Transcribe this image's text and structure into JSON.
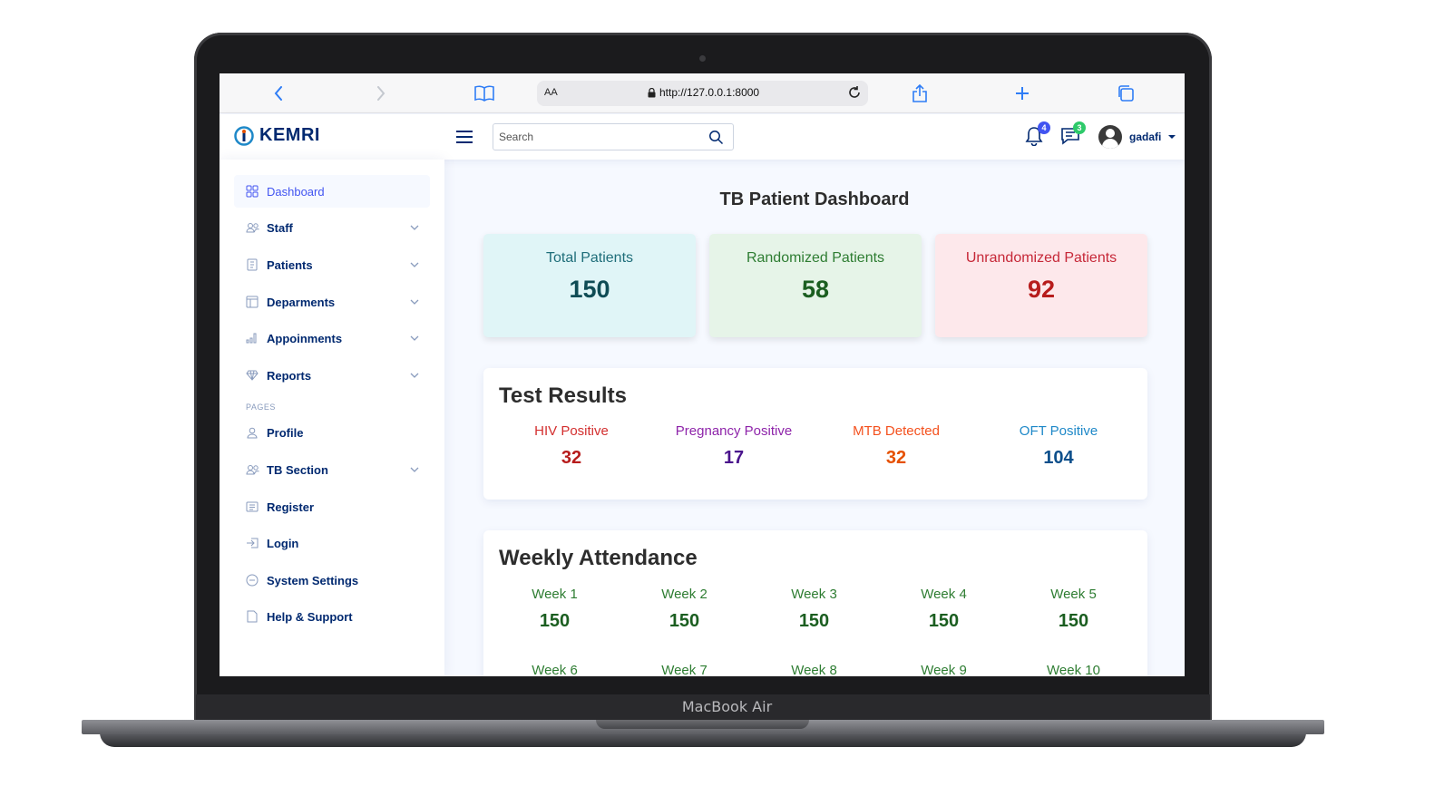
{
  "device": {
    "label": "MacBook Air"
  },
  "browser": {
    "text_size_label": "AA",
    "url": "http://127.0.0.1:8000"
  },
  "header": {
    "brand": "KEMRI",
    "search_placeholder": "Search",
    "notifications_count": "4",
    "messages_count": "3",
    "user_name": "gadafi"
  },
  "sidebar": {
    "items": [
      {
        "label": "Dashboard",
        "icon": "grid-icon"
      },
      {
        "label": "Staff",
        "icon": "people-icon"
      },
      {
        "label": "Patients",
        "icon": "journal-icon"
      },
      {
        "label": "Deparments",
        "icon": "layout-icon"
      },
      {
        "label": "Appoinments",
        "icon": "bar-chart-icon"
      },
      {
        "label": "Reports",
        "icon": "gem-icon"
      }
    ],
    "pages_heading": "PAGES",
    "pages": [
      {
        "label": "Profile",
        "icon": "person-icon"
      },
      {
        "label": "TB Section",
        "icon": "people-icon"
      },
      {
        "label": "Register",
        "icon": "card-list-icon"
      },
      {
        "label": "Login",
        "icon": "box-arrow-in-icon"
      },
      {
        "label": "System Settings",
        "icon": "dash-circle-icon"
      },
      {
        "label": "Help & Support",
        "icon": "file-icon"
      }
    ]
  },
  "dashboard": {
    "title": "TB Patient Dashboard",
    "stats": [
      {
        "label": "Total Patients",
        "value": "150",
        "bg": "#e0f5f7",
        "label_color": "#1f6e7a",
        "value_color": "#0f4c55"
      },
      {
        "label": "Randomized Patients",
        "value": "58",
        "bg": "#e6f4e8",
        "label_color": "#2e7d32",
        "value_color": "#1b5e20"
      },
      {
        "label": "Unrandomized Patients",
        "value": "92",
        "bg": "#fde8eb",
        "label_color": "#c62838",
        "value_color": "#b71c1c"
      }
    ],
    "test_results": {
      "title": "Test Results",
      "items": [
        {
          "label": "HIV Positive",
          "value": "32",
          "label_color": "#d32f2f",
          "value_color": "#b71c1c"
        },
        {
          "label": "Pregnancy Positive",
          "value": "17",
          "label_color": "#8e24aa",
          "value_color": "#4a148c"
        },
        {
          "label": "MTB Detected",
          "value": "32",
          "label_color": "#f4511e",
          "value_color": "#e65100"
        },
        {
          "label": "OFT Positive",
          "value": "104",
          "label_color": "#1e88c8",
          "value_color": "#0d4f8b"
        }
      ]
    },
    "weekly_attendance": {
      "title": "Weekly Attendance",
      "weeks": [
        {
          "label": "Week 1",
          "value": "150"
        },
        {
          "label": "Week 2",
          "value": "150"
        },
        {
          "label": "Week 3",
          "value": "150"
        },
        {
          "label": "Week 4",
          "value": "150"
        },
        {
          "label": "Week 5",
          "value": "150"
        },
        {
          "label": "Week 6",
          "value": ""
        },
        {
          "label": "Week 7",
          "value": ""
        },
        {
          "label": "Week 8",
          "value": ""
        },
        {
          "label": "Week 9",
          "value": ""
        },
        {
          "label": "Week 10",
          "value": ""
        }
      ]
    }
  }
}
